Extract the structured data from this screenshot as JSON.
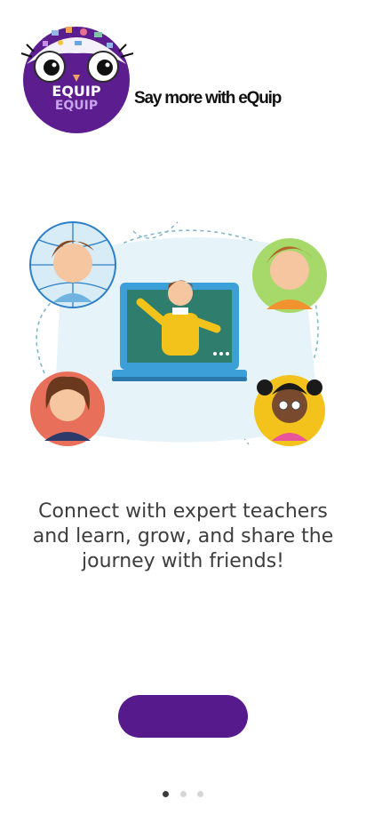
{
  "brand": {
    "logo_text_top": "EQUIP",
    "logo_text_bottom": "EQUIP",
    "tagline": "Say more with eQuip"
  },
  "onboarding": {
    "message_line1": "Connect with expert teachers",
    "message_line2": "and learn, grow, and share the",
    "message_line3": "journey with friends!",
    "cta_label": "",
    "page_count": 3,
    "active_page": 1
  },
  "colors": {
    "brand_purple": "#561a8c",
    "text": "#3d3d3d",
    "dot_active": "#3a3a3a",
    "dot_inactive": "#d6d6d6"
  }
}
